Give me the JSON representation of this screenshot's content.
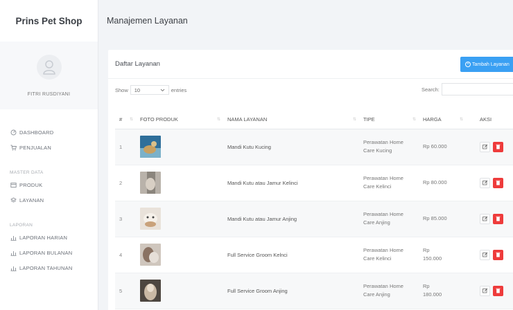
{
  "app": {
    "brand": "Prins Pet Shop",
    "user_name": "FITRI RUSDIYANI"
  },
  "sidebar": {
    "items": [
      {
        "label": "DASHBOARD",
        "icon": "dashboard-icon"
      },
      {
        "label": "PENJUALAN",
        "icon": "cart-icon"
      }
    ],
    "master_heading": "MASTER DATA",
    "master_items": [
      {
        "label": "PRODUK",
        "icon": "box-icon"
      },
      {
        "label": "LAYANAN",
        "icon": "layers-icon"
      }
    ],
    "laporan_heading": "LAPORAN",
    "laporan_items": [
      {
        "label": "LAPORAN HARIAN",
        "icon": "bar-chart-icon"
      },
      {
        "label": "LAPORAN BULANAN",
        "icon": "bar-chart-icon"
      },
      {
        "label": "LAPORAN TAHUNAN",
        "icon": "bar-chart-icon"
      }
    ]
  },
  "header": {
    "title": "Manajemen Layanan"
  },
  "card": {
    "title": "Daftar Layanan",
    "add_button": "Tambah Layanan",
    "show_label": "Show",
    "entries_value": "10",
    "entries_label": "entries",
    "search_label": "Search:"
  },
  "table": {
    "columns": [
      "#",
      "FOTO PRODUK",
      "NAMA LAYANAN",
      "TIPE",
      "HARGA",
      "AKSI"
    ],
    "rows": [
      {
        "no": "1",
        "nama": "Mandi Kutu Kucing",
        "tipe_1": "Perawatan Home",
        "tipe_2": "Care Kucing",
        "harga_1": "Rp 60.000",
        "harga_2": ""
      },
      {
        "no": "2",
        "nama": "Mandi Kutu atau Jamur Kelinci",
        "tipe_1": "Perawatan Home",
        "tipe_2": "Care Kelinci",
        "harga_1": "Rp 80.000",
        "harga_2": ""
      },
      {
        "no": "3",
        "nama": "Mandi Kutu atau Jamur Anjing",
        "tipe_1": "Perawatan Home",
        "tipe_2": "Care Anjing",
        "harga_1": "Rp 85.000",
        "harga_2": ""
      },
      {
        "no": "4",
        "nama": "Full Service Groom Kelnci",
        "tipe_1": "Perawatan Home",
        "tipe_2": "Care Kelinci",
        "harga_1": "Rp",
        "harga_2": "150.000"
      },
      {
        "no": "5",
        "nama": "Full Service Groom Anjing",
        "tipe_1": "Perawatan Home",
        "tipe_2": "Care Anjing",
        "harga_1": "Rp",
        "harga_2": "180.000"
      }
    ]
  },
  "colors": {
    "accent": "#3aa0f3",
    "danger": "#ee3b3b"
  }
}
